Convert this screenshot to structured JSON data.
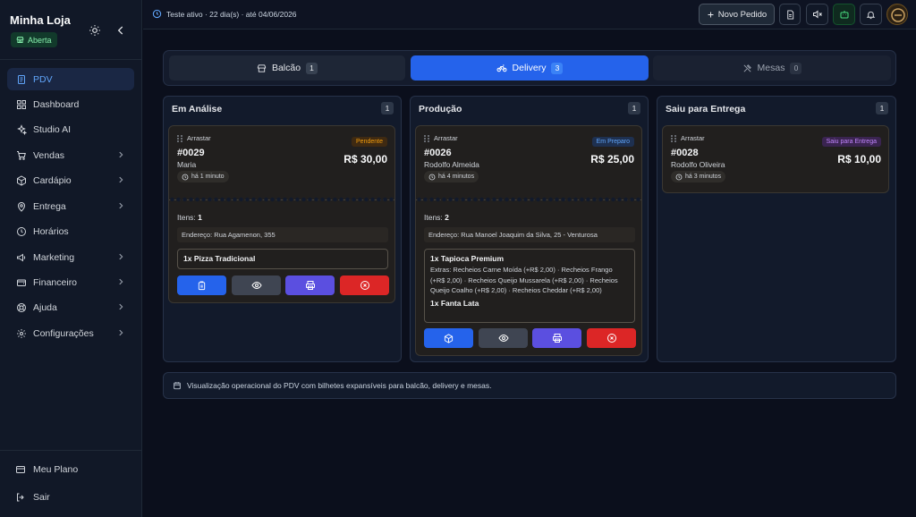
{
  "sidebar": {
    "store_name": "Minha Loja",
    "status": "Aberta",
    "nav": [
      {
        "label": "PDV",
        "icon": "receipt-icon",
        "active": true
      },
      {
        "label": "Dashboard",
        "icon": "dashboard-icon"
      },
      {
        "label": "Studio AI",
        "icon": "sparkles-icon"
      },
      {
        "label": "Vendas",
        "icon": "cart-icon"
      },
      {
        "label": "Cardápio",
        "icon": "box-icon"
      },
      {
        "label": "Entrega",
        "icon": "map-pin-icon"
      },
      {
        "label": "Horários",
        "icon": "clock-icon"
      },
      {
        "label": "Marketing",
        "icon": "megaphone-icon"
      },
      {
        "label": "Financeiro",
        "icon": "wallet-icon"
      },
      {
        "label": "Ajuda",
        "icon": "lifebuoy-icon"
      },
      {
        "label": "Configurações",
        "icon": "gear-icon"
      }
    ],
    "footer": {
      "plan": "Meu Plano",
      "logout": "Sair"
    }
  },
  "topbar": {
    "trial_text": "Teste ativo · 22 dia(s) · até 04/06/2026",
    "new_order_label": "Novo Pedido"
  },
  "tabs": [
    {
      "label": "Balcão",
      "count": "1"
    },
    {
      "label": "Delivery",
      "count": "3",
      "active": true
    },
    {
      "label": "Mesas",
      "count": "0"
    }
  ],
  "columns": [
    {
      "title": "Em Análise",
      "count": "1",
      "ticket": {
        "drag": "Arrastar",
        "id": "#0029",
        "customer": "Maria",
        "time": "há 1 minuto",
        "badge": "Pendente",
        "price": "R$ 30,00",
        "items_label": "Itens:",
        "items_count": "1",
        "address": "Endereço: Rua Agamenon, 355",
        "products": [
          {
            "name": "1x Pizza Tradicional"
          }
        ]
      }
    },
    {
      "title": "Produção",
      "count": "1",
      "ticket": {
        "drag": "Arrastar",
        "id": "#0026",
        "customer": "Rodolfo Almeida",
        "time": "há 4 minutos",
        "badge": "Em Preparo",
        "price": "R$ 25,00",
        "items_label": "Itens:",
        "items_count": "2",
        "address": "Endereço: Rua Manoel Joaquim da Silva, 25 - Venturosa",
        "products": [
          {
            "name": "1x Tapioca Premium",
            "extras": "Extras: Recheios Carne Moída (+R$ 2,00) · Recheios Frango (+R$ 2,00) · Recheios Queijo Mussarela (+R$ 2,00) · Recheios Queijo Coalho (+R$ 2,00) · Recheios Cheddar (+R$ 2,00)"
          },
          {
            "name": "1x Fanta Lata"
          }
        ]
      }
    },
    {
      "title": "Saiu para Entrega",
      "count": "1",
      "ticket": {
        "drag": "Arrastar",
        "id": "#0028",
        "customer": "Rodolfo Oliveira",
        "time": "há 3 minutos",
        "badge": "Saiu para Entrega",
        "price": "R$ 10,00"
      }
    }
  ],
  "info_text": "Visualização operacional do PDV com bilhetes expansíveis para balcão, delivery e mesas.",
  "colors": {
    "accent": "#2563eb",
    "pending": "#f59e0b",
    "preparing": "#60a5fa",
    "out_for_delivery": "#c084fc",
    "danger": "#dc2626",
    "print": "#5b4fe0"
  }
}
